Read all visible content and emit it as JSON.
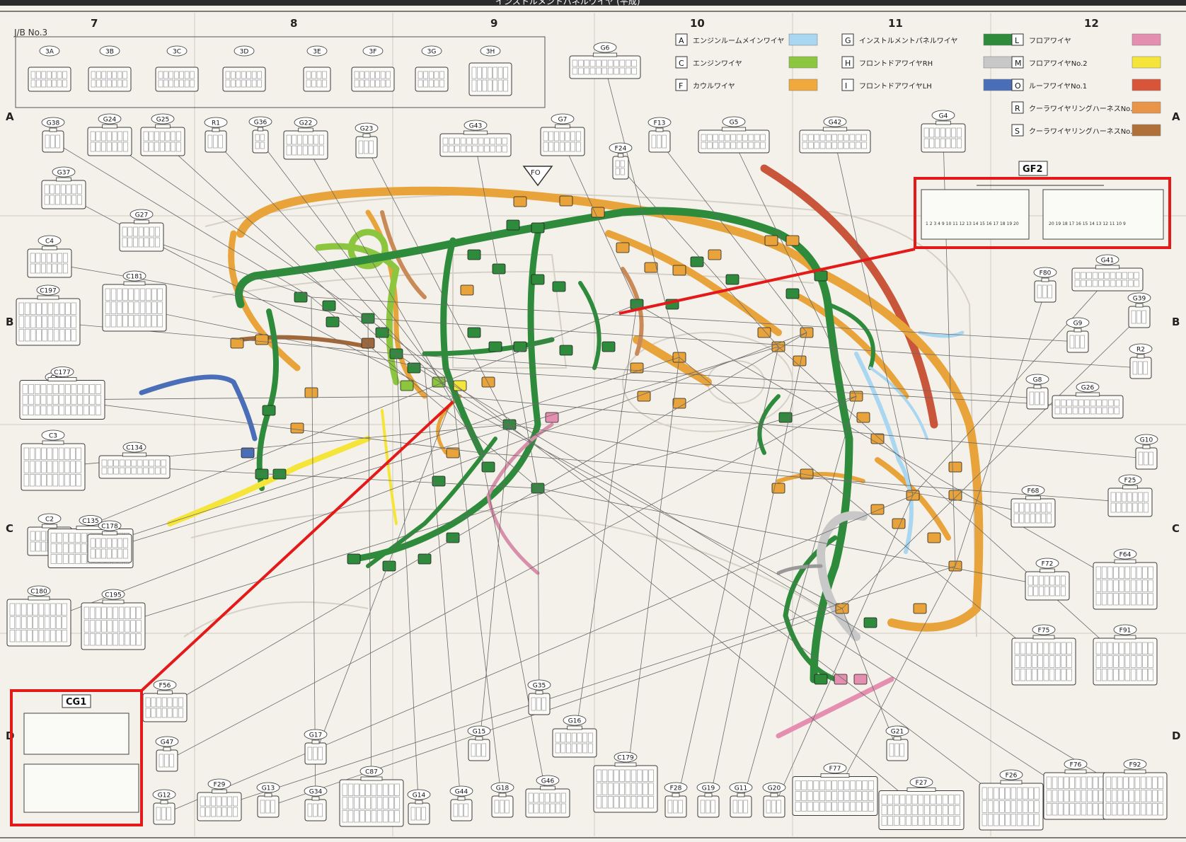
{
  "header": {
    "title": "インストルメントパネルワイヤ (平成)"
  },
  "columns": [
    "7",
    "8",
    "9",
    "10",
    "11",
    "12"
  ],
  "rows": [
    "A",
    "B",
    "C",
    "D"
  ],
  "jb_title": "J/B No.3",
  "jb_connectors": [
    "3A",
    "3B",
    "3C",
    "3D",
    "3E",
    "3F",
    "3G",
    "3H"
  ],
  "legend": [
    {
      "code": "A",
      "label": "エンジンルームメインワイヤ",
      "color": "#a9d6f0"
    },
    {
      "code": "C",
      "label": "エンジンワイヤ",
      "color": "#8cc63f"
    },
    {
      "code": "F",
      "label": "カウルワイヤ",
      "color": "#f2a93b"
    },
    {
      "code": "G",
      "label": "インストルメントパネルワイヤ",
      "color": "#2e8b3c"
    },
    {
      "code": "H",
      "label": "フロントドアワイヤRH",
      "color": "#c8c8c8"
    },
    {
      "code": "I",
      "label": "フロントドアワイヤLH",
      "color": "#4a6fb8"
    },
    {
      "code": "L",
      "label": "フロアワイヤ",
      "color": "#e58fb0"
    },
    {
      "code": "M",
      "label": "フロアワイヤNo.2",
      "color": "#f5e53a"
    },
    {
      "code": "O",
      "label": "ルーフワイヤNo.1",
      "color": "#d9553a"
    },
    {
      "code": "R",
      "label": "クーラワイヤリングハーネスNo.1",
      "color": "#e8954a"
    },
    {
      "code": "S",
      "label": "クーラワイヤリングハーネスNo.2",
      "color": "#b0703a"
    }
  ],
  "labels": {
    "fo_marker": "FO",
    "callout_gf2": "GF2",
    "callout_cg1": "CG1",
    "gf2_pins_top": "1 2 3 4   9 10 11 12 13 14 15 16 17 18 19 20",
    "gf2_pins_right": "20 19 18 17 16 15 14 13 12 11 10 9"
  },
  "connectors": [
    {
      "id": "G38"
    },
    {
      "id": "G24"
    },
    {
      "id": "G25"
    },
    {
      "id": "R1"
    },
    {
      "id": "G36"
    },
    {
      "id": "G22"
    },
    {
      "id": "G23"
    },
    {
      "id": "G43"
    },
    {
      "id": "G7"
    },
    {
      "id": "G6"
    },
    {
      "id": "F24"
    },
    {
      "id": "F13"
    },
    {
      "id": "G5"
    },
    {
      "id": "G42"
    },
    {
      "id": "G4"
    },
    {
      "id": "G37"
    },
    {
      "id": "G27"
    },
    {
      "id": "C4"
    },
    {
      "id": "C197"
    },
    {
      "id": "C181"
    },
    {
      "id": "C88"
    },
    {
      "id": "C177"
    },
    {
      "id": "C3"
    },
    {
      "id": "C134"
    },
    {
      "id": "C2"
    },
    {
      "id": "C135"
    },
    {
      "id": "C178"
    },
    {
      "id": "C180"
    },
    {
      "id": "C195"
    },
    {
      "id": "G41"
    },
    {
      "id": "F80"
    },
    {
      "id": "G39"
    },
    {
      "id": "G9"
    },
    {
      "id": "R2"
    },
    {
      "id": "G8"
    },
    {
      "id": "G26"
    },
    {
      "id": "G10"
    },
    {
      "id": "F25"
    },
    {
      "id": "F68"
    },
    {
      "id": "F72"
    },
    {
      "id": "F64"
    },
    {
      "id": "F75"
    },
    {
      "id": "F91"
    },
    {
      "id": "F56"
    },
    {
      "id": "G47"
    },
    {
      "id": "G12"
    },
    {
      "id": "F29"
    },
    {
      "id": "G13"
    },
    {
      "id": "G34"
    },
    {
      "id": "C87"
    },
    {
      "id": "G14"
    },
    {
      "id": "G44"
    },
    {
      "id": "G18"
    },
    {
      "id": "G46"
    },
    {
      "id": "G15"
    },
    {
      "id": "G35"
    },
    {
      "id": "G16"
    },
    {
      "id": "C179"
    },
    {
      "id": "F28"
    },
    {
      "id": "G19"
    },
    {
      "id": "G11"
    },
    {
      "id": "G20"
    },
    {
      "id": "F77"
    },
    {
      "id": "G21"
    },
    {
      "id": "F27"
    },
    {
      "id": "F26"
    },
    {
      "id": "F76"
    },
    {
      "id": "F92"
    },
    {
      "id": "G17"
    }
  ]
}
